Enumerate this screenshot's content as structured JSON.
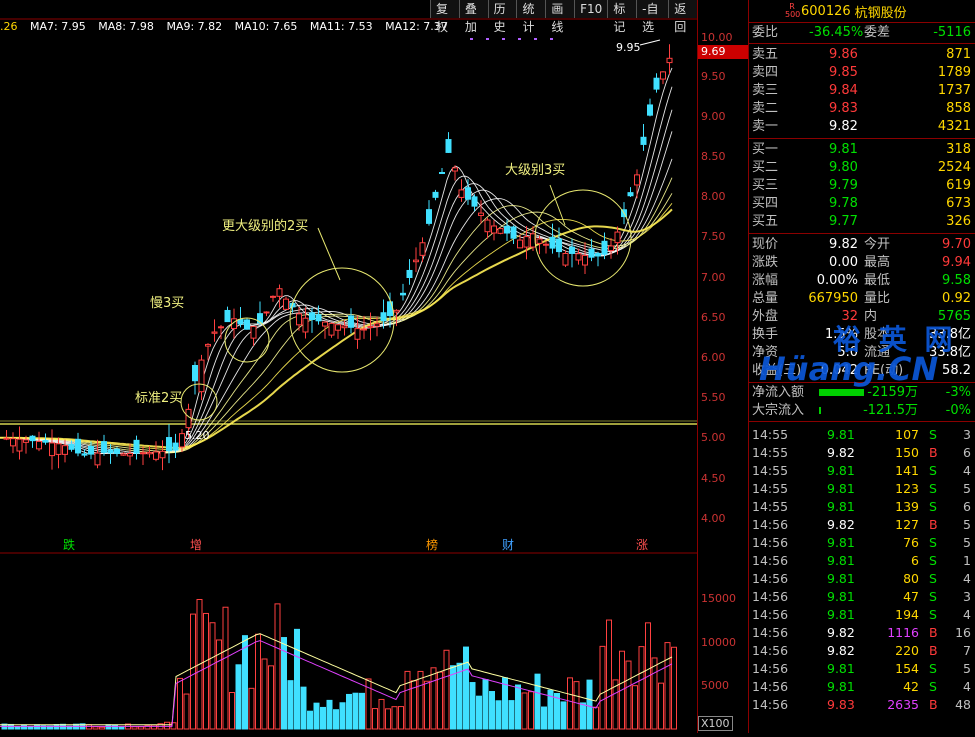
{
  "toolbar": [
    "复权",
    "叠加",
    "历史",
    "统计",
    "画线",
    "F10",
    "标记",
    "-自选",
    "返回"
  ],
  "ma_row": [
    {
      "label": ".26",
      "color": "#ffd700"
    },
    {
      "label": "MA7: 7.95",
      "color": "#ffffff"
    },
    {
      "label": "MA8: 7.98",
      "color": "#ffffff"
    },
    {
      "label": "MA9: 7.82",
      "color": "#ffffff"
    },
    {
      "label": "MA10: 7.65",
      "color": "#ffffff"
    },
    {
      "label": "MA11: 7.53",
      "color": "#ffffff"
    },
    {
      "label": "MA12: 7.37",
      "color": "#ffffff"
    }
  ],
  "price_axis": [
    "10.00",
    "9.50",
    "9.00",
    "8.50",
    "8.00",
    "7.50",
    "7.00",
    "6.50",
    "6.00",
    "5.50",
    "5.00",
    "4.50",
    "4.00"
  ],
  "current_price_tag": "9.69",
  "volume_axis": [
    "15000",
    "10000",
    "5000"
  ],
  "volume_unit": "X100",
  "annotations": {
    "standard_buy2": "标准2买",
    "slow_buy3": "慢3买",
    "bigger_level_buy2": "更大级别的2买",
    "big_level_buy3": "大级别3买",
    "high_mark": "9.95",
    "low_mark": "5.20"
  },
  "events": [
    {
      "label": "跌",
      "color": "#00e000"
    },
    {
      "label": "增",
      "color": "#ff5050"
    },
    {
      "label": "榜",
      "color": "#ff9900"
    },
    {
      "label": "财",
      "color": "#40a0ff"
    },
    {
      "label": "涨",
      "color": "#ff5050"
    }
  ],
  "watermark": {
    "line1": "裕 英 网",
    "line2": "Hüang.CN"
  },
  "stock": {
    "badge": "R 500",
    "code": "600126",
    "name": "杭钢股份"
  },
  "committee": {
    "ratio_label": "委比",
    "ratio_value": "-36.45%",
    "diff_label": "委差",
    "diff_value": "-5116"
  },
  "asks": [
    {
      "label": "卖五",
      "price": "9.86",
      "vol": "871"
    },
    {
      "label": "卖四",
      "price": "9.85",
      "vol": "1789"
    },
    {
      "label": "卖三",
      "price": "9.84",
      "vol": "1737"
    },
    {
      "label": "卖二",
      "price": "9.83",
      "vol": "858"
    },
    {
      "label": "卖一",
      "price": "9.82",
      "vol": "4321"
    }
  ],
  "bids": [
    {
      "label": "买一",
      "price": "9.81",
      "vol": "318"
    },
    {
      "label": "买二",
      "price": "9.80",
      "vol": "2524"
    },
    {
      "label": "买三",
      "price": "9.79",
      "vol": "619"
    },
    {
      "label": "买四",
      "price": "9.78",
      "vol": "673"
    },
    {
      "label": "买五",
      "price": "9.77",
      "vol": "326"
    }
  ],
  "stats": [
    {
      "l1": "现价",
      "v1": "9.82",
      "c1": "white",
      "l2": "今开",
      "v2": "9.70",
      "c2": "red"
    },
    {
      "l1": "涨跌",
      "v1": "0.00",
      "c1": "white",
      "l2": "最高",
      "v2": "9.94",
      "c2": "red"
    },
    {
      "l1": "涨幅",
      "v1": "0.00%",
      "c1": "white",
      "l2": "最低",
      "v2": "9.58",
      "c2": "green"
    },
    {
      "l1": "总量",
      "v1": "667950",
      "c1": "yellow",
      "l2": "量比",
      "v2": "0.92",
      "c2": "yellow"
    },
    {
      "l1": "外盘",
      "v1": "32",
      "c1": "red",
      "l2": "内",
      "v2": "5765",
      "c2": "green"
    },
    {
      "l1": "换手",
      "v1": "1.5%",
      "c1": "white",
      "l2": "股本",
      "v2": "33.8亿",
      "c2": "white"
    },
    {
      "l1": "净资",
      "v1": "5.0",
      "c1": "white",
      "l2": "流通",
      "v2": "33.8亿",
      "c2": "white"
    },
    {
      "l1": "收益(三)",
      "v1": "0.042",
      "c1": "white",
      "l2": "PE(动)",
      "v2": "58.2",
      "c2": "white"
    }
  ],
  "flows": [
    {
      "label": "净流入额",
      "value": "-2159万",
      "pct": "-3%",
      "bar_fraction": 0.6
    },
    {
      "label": "大宗流入",
      "value": "-121.5万",
      "pct": "-0%",
      "bar_fraction": 0.02
    }
  ],
  "trades": [
    {
      "time": "14:55",
      "price": "9.81",
      "vol": "107",
      "side": "S",
      "count": "3"
    },
    {
      "time": "14:55",
      "price": "9.82",
      "vol": "150",
      "side": "B",
      "count": "6"
    },
    {
      "time": "14:55",
      "price": "9.81",
      "vol": "141",
      "side": "S",
      "count": "4"
    },
    {
      "time": "14:55",
      "price": "9.81",
      "vol": "123",
      "side": "S",
      "count": "5"
    },
    {
      "time": "14:55",
      "price": "9.81",
      "vol": "139",
      "side": "S",
      "count": "6"
    },
    {
      "time": "14:56",
      "price": "9.82",
      "vol": "127",
      "side": "B",
      "count": "5"
    },
    {
      "time": "14:56",
      "price": "9.81",
      "vol": "76",
      "side": "S",
      "count": "5"
    },
    {
      "time": "14:56",
      "price": "9.81",
      "vol": "6",
      "side": "S",
      "count": "1"
    },
    {
      "time": "14:56",
      "price": "9.81",
      "vol": "80",
      "side": "S",
      "count": "4"
    },
    {
      "time": "14:56",
      "price": "9.81",
      "vol": "47",
      "side": "S",
      "count": "3"
    },
    {
      "time": "14:56",
      "price": "9.81",
      "vol": "194",
      "side": "S",
      "count": "4"
    },
    {
      "time": "14:56",
      "price": "9.82",
      "vol": "1116",
      "side": "B",
      "count": "16"
    },
    {
      "time": "14:56",
      "price": "9.82",
      "vol": "220",
      "side": "B",
      "count": "7"
    },
    {
      "time": "14:56",
      "price": "9.81",
      "vol": "154",
      "side": "S",
      "count": "5"
    },
    {
      "time": "14:56",
      "price": "9.81",
      "vol": "42",
      "side": "S",
      "count": "4"
    },
    {
      "time": "14:56",
      "price": "9.83",
      "vol": "2635",
      "side": "B",
      "count": "48"
    }
  ]
}
